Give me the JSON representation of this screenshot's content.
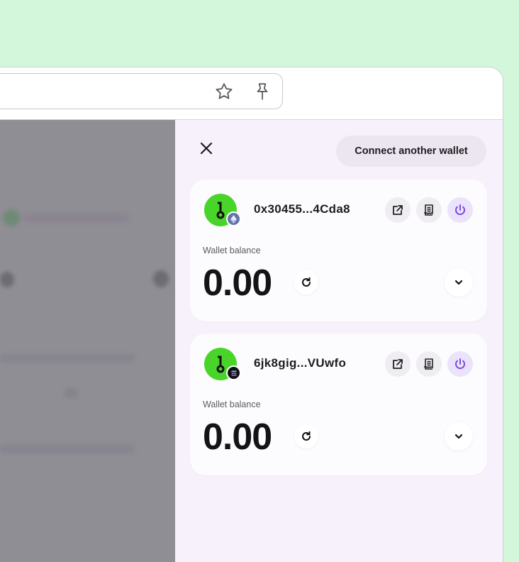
{
  "browser": {
    "address_bar_icons": [
      "star-icon",
      "pin-icon"
    ]
  },
  "drawer": {
    "connect_label": "Connect another wallet",
    "wallets": [
      {
        "address": "0x30455...4Cda8",
        "chain": "ethereum",
        "balance_label": "Wallet balance",
        "balance": "0.00"
      },
      {
        "address": "6jk8gig...VUwfo",
        "chain": "solana",
        "balance_label": "Wallet balance",
        "balance": "0.00"
      }
    ]
  },
  "colors": {
    "background": "#d3f7da",
    "drawer_bg": "#f6f1fb",
    "avatar_green": "#49d42a",
    "power_accent": "#7b3fe4",
    "eth_badge": "#6472a8",
    "sol_badge": "#111111"
  }
}
